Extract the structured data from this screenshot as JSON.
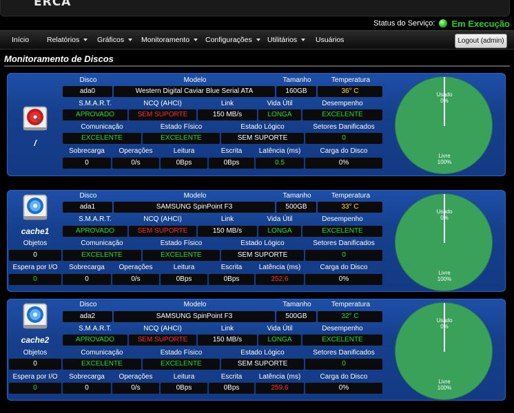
{
  "header": {
    "logo_text": "ERCA",
    "status_label": "Status do Serviço:",
    "status_value": "Em Execução"
  },
  "nav": {
    "items": [
      "Início",
      "Relatórios",
      "Gráficos",
      "Monitoramento",
      "Configurações",
      "Utilitários",
      "Usuários"
    ],
    "logout_label": "Logout (admin)"
  },
  "section_title": "Monitoramento de Discos",
  "headers": {
    "disco": "Disco",
    "modelo": "Modelo",
    "tamanho": "Tamanho",
    "temperatura": "Temperatura",
    "smart": "S.M.A.R.T.",
    "ncq": "NCQ (AHCI)",
    "link": "Link",
    "vida_util": "Vida Útil",
    "desempenho": "Desempenho",
    "objetos": "Objetos",
    "comunicacao": "Comunicação",
    "estado_fisico": "Estado Físico",
    "estado_logico": "Estado Lógico",
    "setores": "Setores Danificados",
    "espera": "Espera por I/O",
    "sobrecarga": "Sobrecarga",
    "operacoes": "Operações",
    "leitura": "Leitura",
    "escrita": "Escrita",
    "latencia": "Latência (ms)",
    "carga": "Carga do Disco"
  },
  "pie_labels": {
    "used": "Usado",
    "free": "Livre"
  },
  "disks": [
    {
      "label": "/",
      "disco": "ada0",
      "modelo": "Western Digital Caviar Blue Serial ATA",
      "tamanho": "160GB",
      "temperatura": "36° C",
      "smart": "APROVADO",
      "ncq": "SEM SUPORTE",
      "link": "150 MB/s",
      "vida_util": "LONGA",
      "desempenho": "EXCELENTE",
      "comunicacao": "EXCELENTE",
      "estado_fisico": "EXCELENTE",
      "estado_logico": "SEM SUPORTE",
      "setores": "0",
      "sobrecarga": "0",
      "operacoes": "0/s",
      "leitura": "0Bps",
      "escrita": "0Bps",
      "latencia": "0.5",
      "carga": "0%",
      "used_pct": "0%",
      "free_pct": "100%"
    },
    {
      "label": "cache1",
      "disco": "ada1",
      "modelo": "SAMSUNG SpinPoint F3",
      "tamanho": "500GB",
      "temperatura": "33° C",
      "smart": "APROVADO",
      "ncq": "SEM SUPORTE",
      "link": "150 MB/s",
      "vida_util": "LONGA",
      "desempenho": "EXCELENTE",
      "objetos": "0",
      "comunicacao": "EXCELENTE",
      "estado_fisico": "EXCELENTE",
      "estado_logico": "SEM SUPORTE",
      "setores": "0",
      "espera": "0",
      "sobrecarga": "0",
      "operacoes": "0/s",
      "leitura": "0Bps",
      "escrita": "0Bps",
      "latencia": "252.6",
      "carga": "0%",
      "used_pct": "0%",
      "free_pct": "100%"
    },
    {
      "label": "cache2",
      "disco": "ada2",
      "modelo": "SAMSUNG SpinPoint F3",
      "tamanho": "500GB",
      "temperatura": "32° C",
      "smart": "APROVADO",
      "ncq": "SEM SUPORTE",
      "link": "150 MB/s",
      "vida_util": "LONGA",
      "desempenho": "EXCELENTE",
      "objetos": "0",
      "comunicacao": "EXCELENTE",
      "estado_fisico": "EXCELENTE",
      "estado_logico": "SEM SUPORTE",
      "setores": "0",
      "espera": "0",
      "sobrecarga": "0",
      "operacoes": "0/s",
      "leitura": "0Bps",
      "escrita": "0Bps",
      "latencia": "259.6",
      "carga": "0%",
      "used_pct": "0%",
      "free_pct": "100%"
    }
  ],
  "colors": {
    "ok": "#19e01f",
    "bad": "#ff2a2a",
    "temp": "#ffe11a",
    "pie": "#3aa15b"
  }
}
